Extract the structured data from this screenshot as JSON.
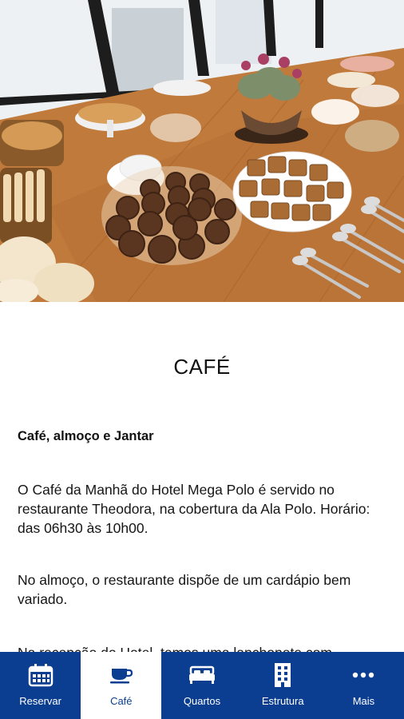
{
  "hero": {
    "image": "breakfast-buffet-photo"
  },
  "page": {
    "title": "CAFÉ",
    "subtitle": "Café, almoço e Jantar",
    "paragraphs": [
      "O Café da Manhã do Hotel Mega Polo é servido no restaurante Theodora, na cobertura da Ala Polo. Horário: das 06h30 às 10h00.",
      "No almoço, o restaurante dispõe de um cardápio bem variado.",
      "Na recepção do Hotel, temos uma lanchonete com"
    ]
  },
  "tabbar": {
    "tabs": [
      {
        "label": "Reservar",
        "icon": "calendar-icon",
        "active": false
      },
      {
        "label": "Café",
        "icon": "coffee-cup-icon",
        "active": true
      },
      {
        "label": "Quartos",
        "icon": "bed-icon",
        "active": false
      },
      {
        "label": "Estrutura",
        "icon": "building-icon",
        "active": false
      },
      {
        "label": "Mais",
        "icon": "more-dots-icon",
        "active": false
      }
    ]
  },
  "colors": {
    "tabbar_bg": "#0b3d91",
    "active_tab_bg": "#ffffff",
    "text": "#111111"
  }
}
